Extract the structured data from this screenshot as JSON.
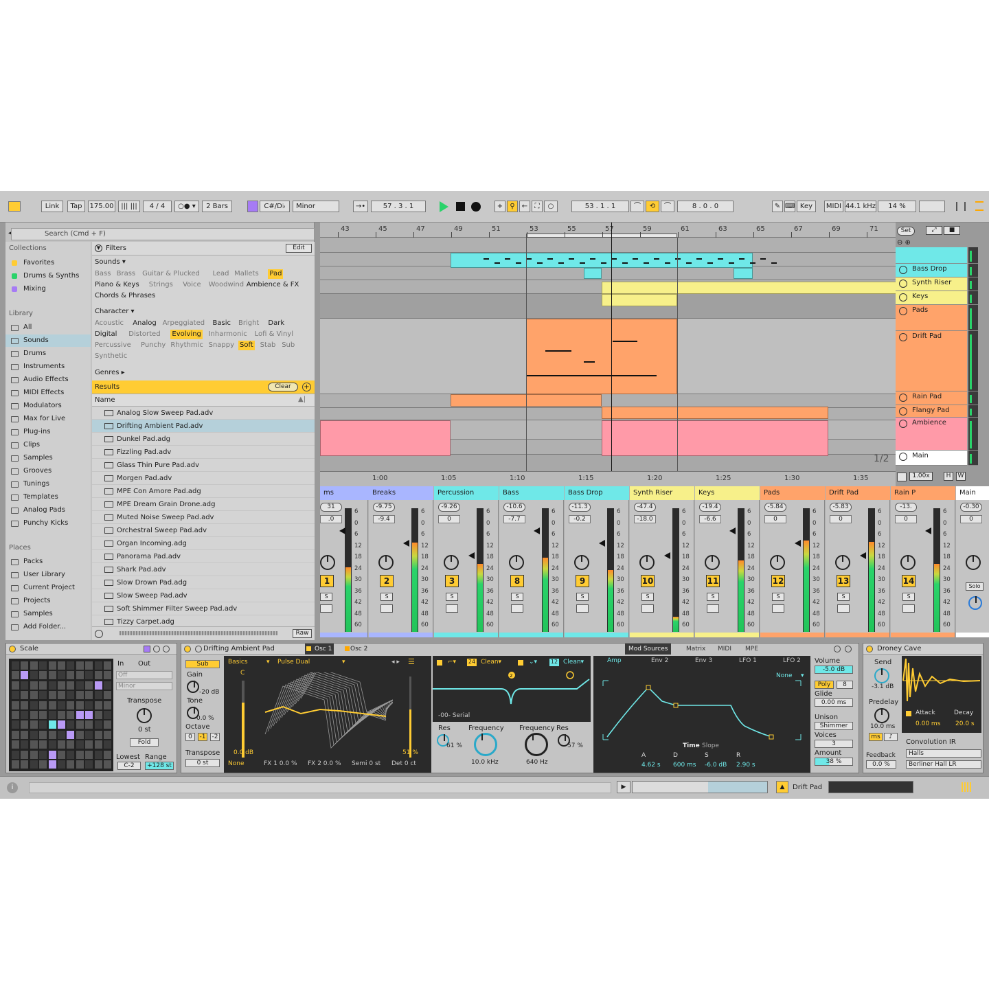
{
  "transport": {
    "link": "Link",
    "tap": "Tap",
    "tempo": "175.00",
    "signature": "4 / 4",
    "quantize": "2 Bars",
    "key": "C#/D♭",
    "scale": "Minor",
    "position": "57 .   3 .   1",
    "loop_start": "53 .   1 .   1",
    "loop_length": "8 .   0 .   0",
    "key_label": "Key",
    "midi_label": "MIDI",
    "sample_rate": "44.1 kHz",
    "cpu": "14 %"
  },
  "browser": {
    "search_placeholder": "Search (Cmd + F)",
    "collections_head": "Collections",
    "collections": [
      {
        "label": "Favorites",
        "color": "#ffcc33"
      },
      {
        "label": "Drums & Synths",
        "color": "#2ad36a"
      },
      {
        "label": "Mixing",
        "color": "#a67bf5"
      }
    ],
    "library_head": "Library",
    "library": [
      "All",
      "Sounds",
      "Drums",
      "Instruments",
      "Audio Effects",
      "MIDI Effects",
      "Modulators",
      "Max for Live",
      "Plug-ins",
      "Clips",
      "Samples",
      "Grooves",
      "Tunings",
      "Templates",
      "Analog Pads",
      "Punchy Kicks"
    ],
    "places_head": "Places",
    "places": [
      "Packs",
      "User Library",
      "Current Project",
      "Projects",
      "Samples",
      "Add Folder..."
    ],
    "filters_label": "Filters",
    "edit_label": "Edit",
    "sounds_label": "Sounds ▾",
    "sounds_tags": [
      "Bass",
      "Brass",
      "Guitar & Plucked",
      "Lead",
      "Mallets",
      "Pad",
      "Piano & Keys",
      "Strings",
      "Voice",
      "Woodwind",
      "Ambience & FX",
      "Chords & Phrases"
    ],
    "character_label": "Character ▾",
    "character_tags": [
      "Acoustic",
      "Analog",
      "Arpeggiated",
      "Basic",
      "Bright",
      "Dark",
      "Digital",
      "Distorted",
      "Evolving",
      "Inharmonic",
      "Lofi & Vinyl",
      "Percussive",
      "Punchy",
      "Rhythmic",
      "Snappy",
      "Soft",
      "Stab",
      "Sub",
      "Synthetic"
    ],
    "genres_label": "Genres ▸",
    "results_label": "Results",
    "clear_label": "Clear",
    "name_header": "Name",
    "results": [
      "Analog Slow Sweep Pad.adv",
      "Drifting Ambient Pad.adv",
      "Dunkel Pad.adg",
      "Fizzling Pad.adv",
      "Glass Thin Pure Pad.adv",
      "Morgen Pad.adv",
      "MPE Con Amore Pad.adg",
      "MPE Dream Grain Drone.adg",
      "Muted Noise Sweep Pad.adv",
      "Orchestral Sweep Pad.adv",
      "Organ Incoming.adg",
      "Panorama Pad.adv",
      "Shark Pad.adv",
      "Slow Drown Pad.adg",
      "Slow Sweep Pad.adv",
      "Soft Shimmer Filter Sweep Pad.adv",
      "Tizzy Carpet.adg"
    ],
    "raw_label": "Raw"
  },
  "arrangement": {
    "bars": [
      "43",
      "45",
      "47",
      "49",
      "51",
      "53",
      "55",
      "57",
      "59",
      "61",
      "63",
      "65",
      "67",
      "69",
      "71"
    ],
    "times": [
      "1:00",
      "1:05",
      "1:10",
      "1:15",
      "1:20",
      "1:25",
      "1:30",
      "1:35"
    ],
    "set_label": "Set",
    "zoom_label": "1/2",
    "zoom_value": "1.00x",
    "tracks": [
      {
        "name": "",
        "color": "#6fe8e8"
      },
      {
        "name": "Bass Drop",
        "color": "#6fe8e8"
      },
      {
        "name": "Synth Riser",
        "color": "#f7f08a"
      },
      {
        "name": "Keys",
        "color": "#f7f08a"
      },
      {
        "name": "Pads",
        "color": "#ffa36a"
      },
      {
        "name": "Drift Pad",
        "color": "#ffa36a"
      },
      {
        "name": "Rain Pad",
        "color": "#ffa36a"
      },
      {
        "name": "Flangy Pad",
        "color": "#ffa36a"
      },
      {
        "name": "Ambience",
        "color": "#ff9aa8"
      },
      {
        "name": "Main",
        "color": "#ffffff"
      }
    ]
  },
  "mixer": {
    "strips": [
      {
        "name": "ms",
        "color": "#a9b6ff",
        "vol": "31",
        "pan": ".0",
        "num": "1",
        "meter": 0.52
      },
      {
        "name": "Breaks",
        "color": "#a9b6ff",
        "vol": "-9.75",
        "pan": "-9.4",
        "num": "2",
        "meter": 0.72
      },
      {
        "name": "Percussion",
        "color": "#6fe8e8",
        "vol": "-9.26",
        "pan": "0",
        "num": "3",
        "meter": 0.55
      },
      {
        "name": "Bass",
        "color": "#6fe8e8",
        "vol": "-10.6",
        "pan": "-7.7",
        "num": "8",
        "meter": 0.6
      },
      {
        "name": "Bass Drop",
        "color": "#6fe8e8",
        "vol": "-11.3",
        "pan": "-0.2",
        "num": "9",
        "meter": 0.5
      },
      {
        "name": "Synth Riser",
        "color": "#f7f08a",
        "vol": "-47.4",
        "pan": "-18.0",
        "num": "10",
        "meter": 0.12
      },
      {
        "name": "Keys",
        "color": "#f7f08a",
        "vol": "-19.4",
        "pan": "-6.6",
        "num": "11",
        "meter": 0.58
      },
      {
        "name": "Pads",
        "color": "#ffa36a",
        "vol": "-5.84",
        "pan": "0",
        "num": "12",
        "meter": 0.74
      },
      {
        "name": "Drift Pad",
        "color": "#ffa36a",
        "vol": "-5.83",
        "pan": "0",
        "num": "13",
        "meter": 0.73
      },
      {
        "name": "Rain P",
        "color": "#ffa36a",
        "vol": "-13.",
        "pan": "0",
        "num": "14",
        "meter": 0.55
      },
      {
        "name": "Main",
        "color": "#ffffff",
        "vol": "-0.30",
        "pan": "0",
        "num": "",
        "meter": 0.8
      }
    ],
    "scale": [
      "6",
      "0",
      "6",
      "12",
      "18",
      "24",
      "30",
      "36",
      "42",
      "48",
      "60"
    ],
    "solo_label": "Solo",
    "s_label": "S"
  },
  "scaler": {
    "title": "Scale",
    "in": "In",
    "out": "Out",
    "off": "Off",
    "minor": "Minor",
    "transpose": "Transpose",
    "transpose_val": "0 st",
    "fold": "Fold",
    "lowest": "Lowest",
    "range": "Range",
    "lowest_val": "C-2",
    "range_val": "+128 st"
  },
  "synth": {
    "title": "Drifting Ambient Pad",
    "osc1": "Osc 1",
    "osc2": "Osc 2",
    "sub": "Sub",
    "gain": "Gain",
    "gain_val": "-20 dB",
    "tone": "Tone",
    "tone_val": "0.0 %",
    "octave": "Octave",
    "oct": [
      "0",
      "-1",
      "-2"
    ],
    "transpose": "Transpose",
    "transpose_val": "0 st",
    "basics": "Basics",
    "wave": "Pulse Dual",
    "c": "C",
    "lvl": "0.0 dB",
    "pct": "51 %",
    "bottom": [
      "None",
      "FX 1  0.0 %",
      "FX 2  0.0 %",
      "Semi  0 st",
      "Det  0 ct"
    ],
    "filt1": "24",
    "clean1": "Clean▾",
    "filt2": "12",
    "clean2": "Clean▾",
    "serial": "-00-  Serial",
    "res1": "Res",
    "res1_val": "61 %",
    "freq1": "Frequency",
    "freq1_val": "10.0 kHz",
    "freq2": "Frequency",
    "freq2_val": "640 Hz",
    "res2": "Res",
    "res2_val": "57 %",
    "mod_tabs": [
      "Mod Sources",
      "Matrix",
      "MIDI",
      "MPE"
    ],
    "env_tabs": [
      "Amp",
      "Env 2",
      "Env 3",
      "LFO 1",
      "LFO 2"
    ],
    "none": "None",
    "time": "Time",
    "slope": "Slope",
    "adsr_labels": [
      "A",
      "D",
      "S",
      "R"
    ],
    "adsr_vals": [
      "4.62 s",
      "600 ms",
      "-6.0 dB",
      "2.90 s"
    ],
    "volume": "Volume",
    "volume_val": "-5.0 dB",
    "poly": "Poly",
    "poly_n": "8",
    "glide": "Glide",
    "glide_val": "0.00 ms",
    "unison": "Unison",
    "unison_val": "Shimmer",
    "voices": "Voices",
    "voices_val": "3",
    "amount": "Amount",
    "amount_val": "38 %"
  },
  "reverb": {
    "title": "Droney Cave",
    "send": "Send",
    "send_val": "-3.1 dB",
    "predelay": "Predelay",
    "predelay_val": "10.0 ms",
    "ms": "ms",
    "attack": "Attack",
    "attack_val": "0.00 ms",
    "decay": "Decay",
    "decay_val": "20.0 s",
    "conv": "Convolution IR",
    "halls": "Halls",
    "ir": "Berliner Hall LR",
    "feedback": "Feedback",
    "feedback_val": "0.0 %"
  },
  "status": {
    "track": "Drift Pad"
  },
  "colors": {
    "accent": "#ffcc33",
    "green": "#2ad36a",
    "cyan": "#6fe8e8",
    "orange": "#ffa36a",
    "pink": "#ff9aa8",
    "yellow": "#f7f08a",
    "purple": "#a67bf5"
  }
}
